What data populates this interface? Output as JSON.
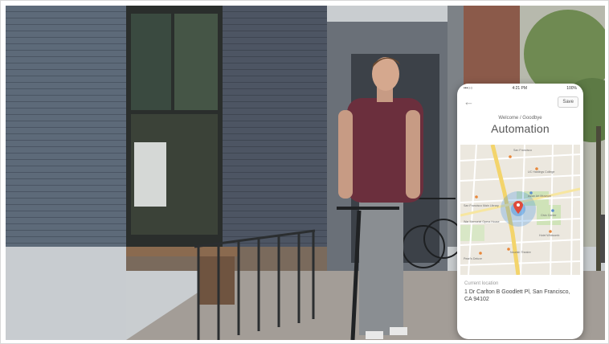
{
  "phone": {
    "status_bar": {
      "carrier": "•••○○ ",
      "time": "4:21 PM",
      "battery": "100%"
    },
    "nav": {
      "back_icon": "back-arrow-icon",
      "save_label": "Save"
    },
    "subtitle": "Welcome / Goodbye",
    "title": "Automation",
    "map": {
      "pin_icon": "location-pin-icon",
      "labels": [
        "San Francisco",
        "UC Hastings College",
        "Asian Art Museum",
        "San Francisco Main Library",
        "Civic Center",
        "War Memorial Opera House",
        "Hotel Whitcomb",
        "Nourish Theatre",
        "Pearl's Deluxe"
      ]
    },
    "location": {
      "caption": "Current location",
      "address": "1 Dr Carlton B Goodlett Pl, San Francisco, CA 94102"
    }
  },
  "colors": {
    "accent_blue": "#3d8fe0",
    "pin_red": "#e04b3a",
    "road_yellow": "#f3d46b"
  }
}
